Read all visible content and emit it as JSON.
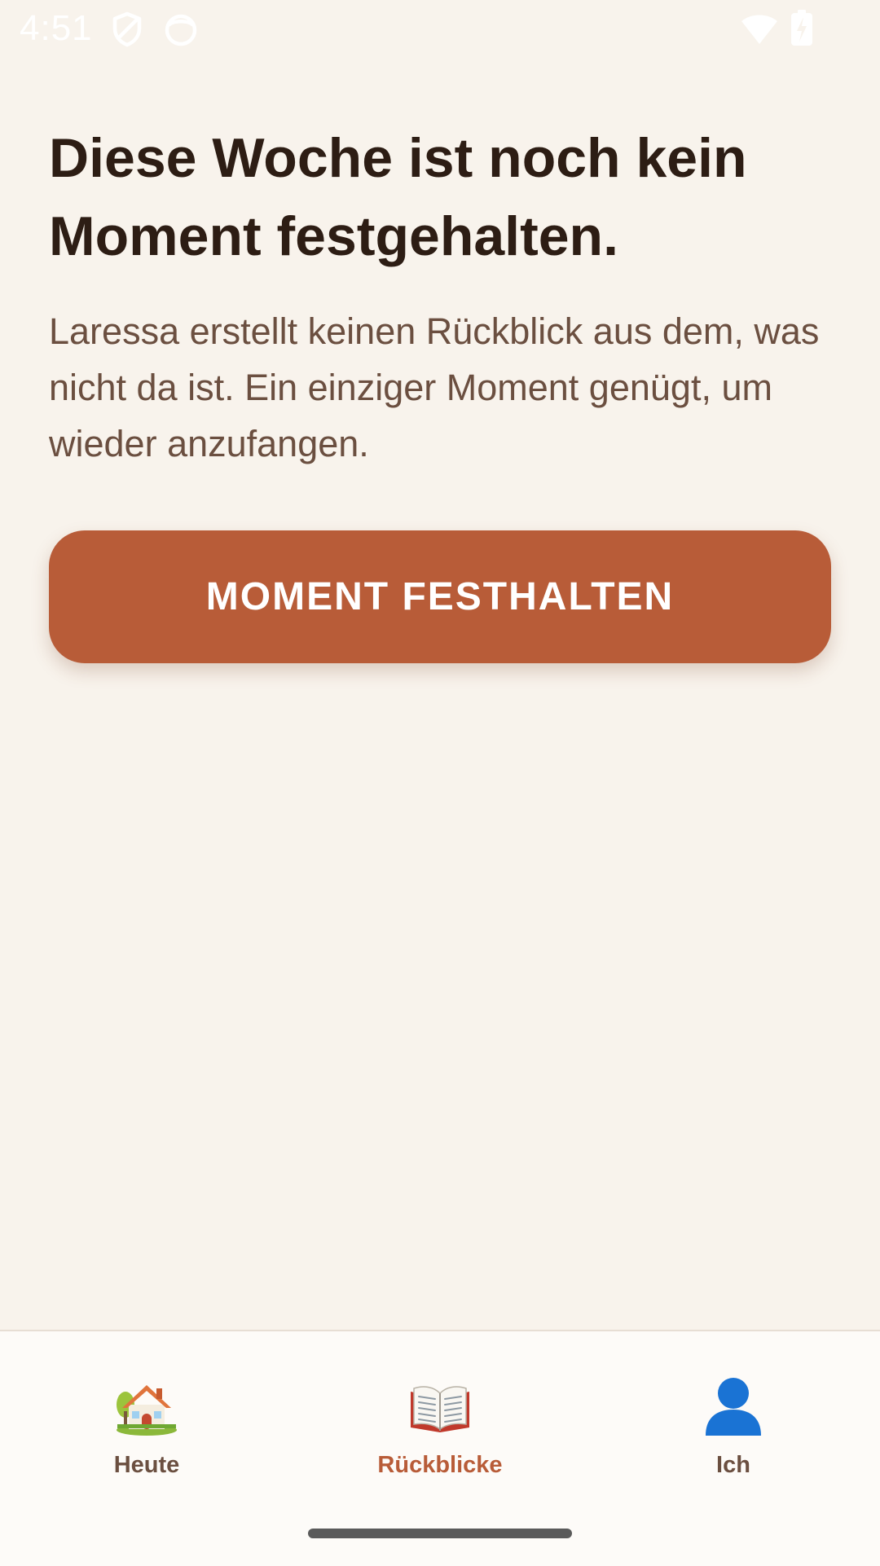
{
  "status_bar": {
    "time": "4:51",
    "icons": [
      "shield-icon",
      "face-icon",
      "wifi-icon",
      "battery-charging-icon"
    ]
  },
  "main": {
    "headline": "Diese Woche ist noch kein Moment festgehalten.",
    "description": "Laressa erstellt keinen Rückblick aus dem, was nicht da ist. Ein einziger Moment genügt, um wieder anzufangen.",
    "cta_label": "MOMENT FESTHALTEN"
  },
  "bottom_nav": {
    "items": [
      {
        "label": "Heute",
        "icon": "house-icon",
        "active": false
      },
      {
        "label": "Rückblicke",
        "icon": "open-book-icon",
        "active": true
      },
      {
        "label": "Ich",
        "icon": "user-silhouette-icon",
        "active": false
      }
    ]
  },
  "colors": {
    "background": "#f8f3ec",
    "accent": "#b85c38",
    "headline": "#2d1d14",
    "body_text": "#6b4f40",
    "nav_background": "#fdfbf8"
  }
}
